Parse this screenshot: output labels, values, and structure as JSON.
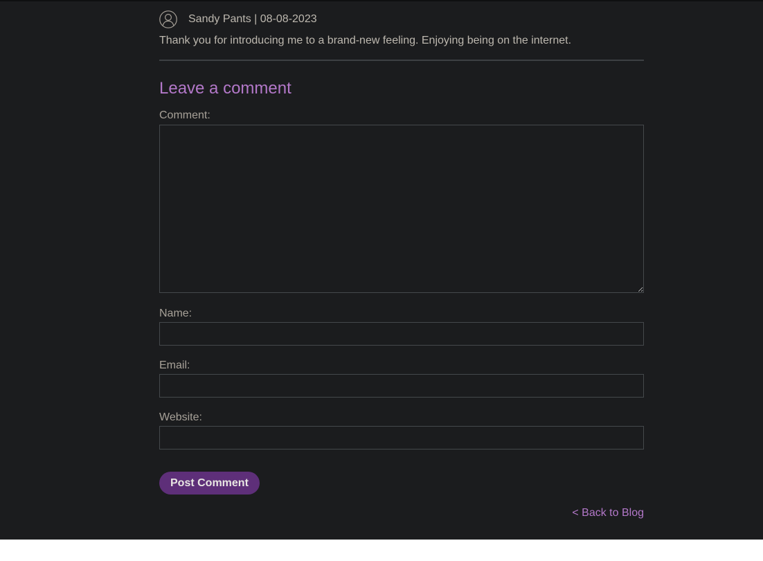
{
  "comment": {
    "author": "Sandy Pants",
    "separator": "|",
    "date": "08-08-2023",
    "meta": "Sandy Pants | 08-08-2023",
    "text": "Thank you for introducing me to a brand-new feeling. Enjoying being on the internet.",
    "avatar_icon": "user-circle-icon"
  },
  "form": {
    "title": "Leave a comment",
    "comment_label": "Comment:",
    "comment_value": "",
    "name_label": "Name:",
    "name_value": "",
    "email_label": "Email:",
    "email_value": "",
    "website_label": "Website:",
    "website_value": "",
    "submit_label": "Post Comment"
  },
  "navigation": {
    "back_link": "< Back to Blog"
  },
  "colors": {
    "background": "#1b1c1e",
    "text": "#bdb8af",
    "label": "#a7a198",
    "accent": "#b378c9",
    "button": "#5e2f79",
    "border": "#45494c"
  }
}
